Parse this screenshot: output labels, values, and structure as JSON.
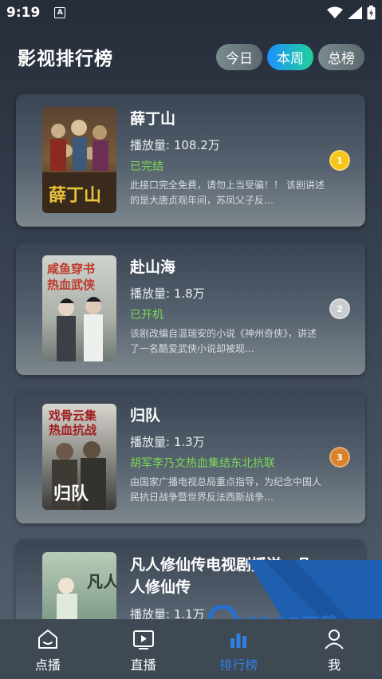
{
  "status_bar": {
    "time": "9:19",
    "app_icon_letter": "A"
  },
  "header": {
    "title": "影视排行榜",
    "tabs": [
      {
        "label": "今日",
        "active": false
      },
      {
        "label": "本周",
        "active": true
      },
      {
        "label": "总榜",
        "active": false
      }
    ]
  },
  "items": [
    {
      "title": "薛丁山",
      "plays": "播放量: 108.2万",
      "status": "已完结",
      "desc": "此接口完全免费，请勿上当受骗！！ 该剧讲述的是大唐贞观年间，苏凤父子反…",
      "rank": "1",
      "rank_color": "#f5c518",
      "poster_text": "薛丁山"
    },
    {
      "title": "赴山海",
      "plays": "播放量: 1.8万",
      "status": "已开机",
      "desc": "该剧改编自温瑞安的小说《神州奇侠》，讲述了一名酷爱武侠小说却被现…",
      "rank": "2",
      "rank_color": "#c9ccd0",
      "poster_text": "咸鱼穿书热血武侠"
    },
    {
      "title": "归队",
      "plays": "播放量: 1.3万",
      "status": "胡军李乃文热血集结东北抗联",
      "desc": "由国家广播电视总局重点指导，为纪念中国人民抗日战争暨世界反法西斯战争…",
      "rank": "3",
      "rank_color": "#d9822b",
      "poster_text": "戏骨云集热血抗战"
    },
    {
      "title": "凡人修仙传电视剧播送—凡人修仙传",
      "plays": "播放量: 1.1万",
      "status": "",
      "desc": "",
      "rank": "",
      "rank_color": "",
      "poster_text": "凡人"
    }
  ],
  "bottom_nav": [
    {
      "label": "点播",
      "icon": "home-icon",
      "active": false
    },
    {
      "label": "直播",
      "icon": "tv-play-icon",
      "active": false
    },
    {
      "label": "排行榜",
      "icon": "chart-bars-icon",
      "active": true
    },
    {
      "label": "我",
      "icon": "person-icon",
      "active": false
    }
  ],
  "watermark": {
    "text": "PCPOP下载",
    "sub": "PCPOP Download"
  },
  "colors": {
    "accent_blue": "#2f7fe0",
    "status_green": "#7ed957"
  }
}
